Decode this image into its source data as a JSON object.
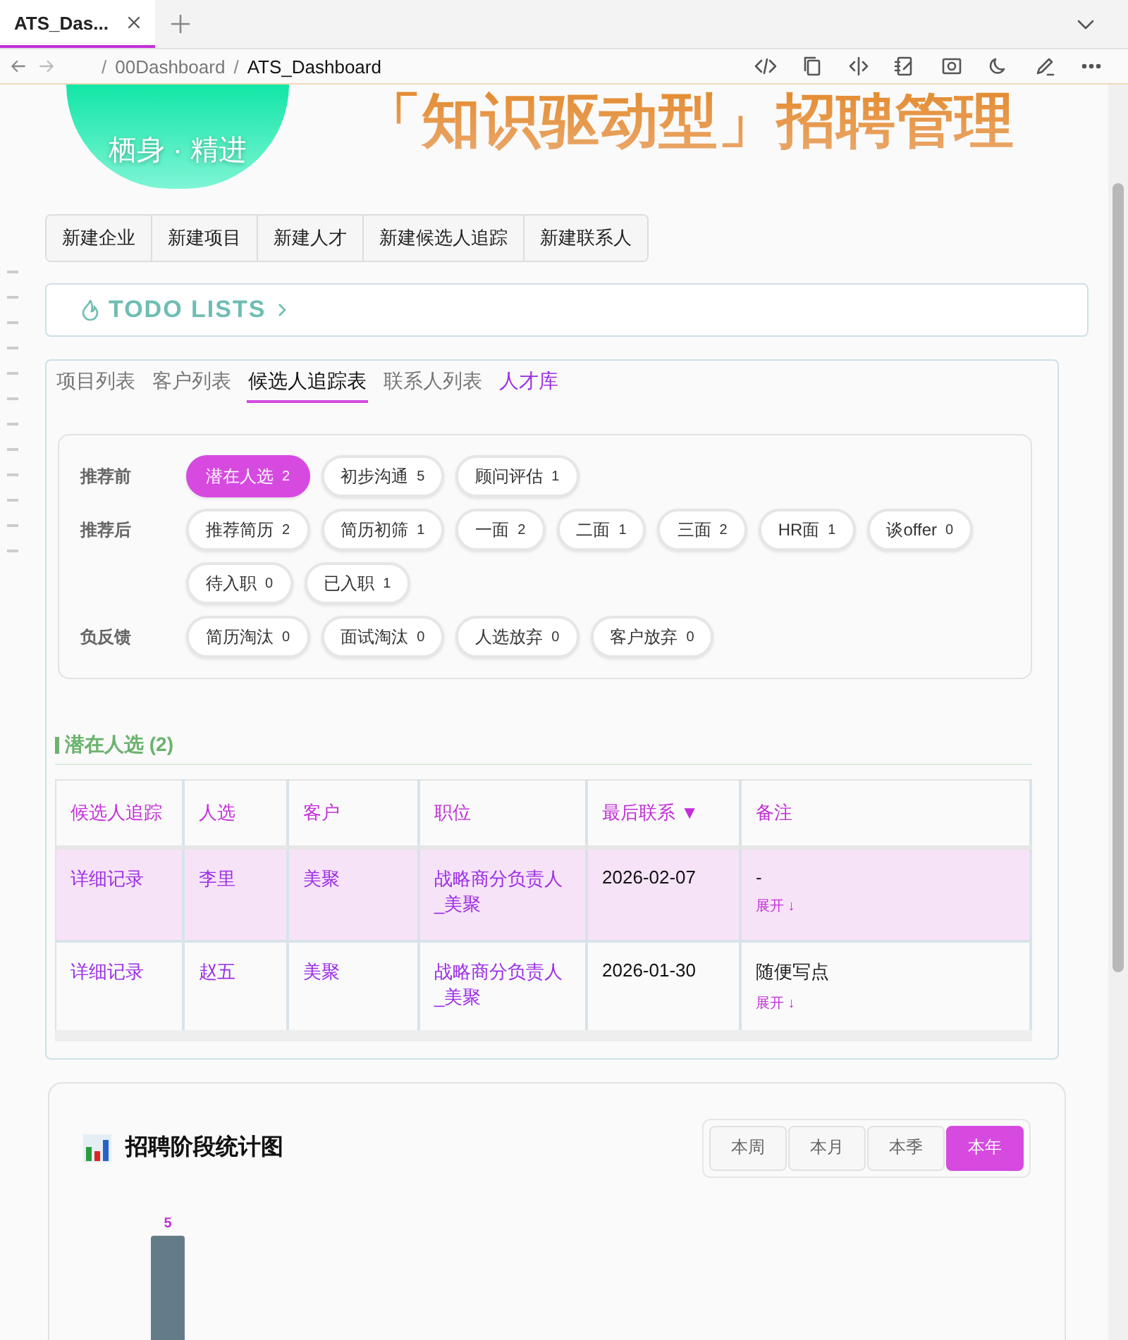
{
  "browser": {
    "tabs": [
      {
        "label": "ATS_Das...",
        "selected": true
      }
    ],
    "breadcrumb": [
      {
        "separator": "/",
        "label": "00Dashboard"
      },
      {
        "separator": "/",
        "label": "ATS_Dashboard"
      }
    ]
  },
  "header": {
    "badge": "栖身 · 精进",
    "title": "「知识驱动型」招聘管理"
  },
  "quick_buttons": [
    "新建企业",
    "新建项目",
    "新建人才",
    "新建候选人追踪",
    "新建联系人"
  ],
  "todo": {
    "label": "TODO LISTS"
  },
  "view_tabs": [
    {
      "label": "项目列表",
      "selected": false,
      "kind": "tab"
    },
    {
      "label": "客户列表",
      "selected": false,
      "kind": "tab"
    },
    {
      "label": "候选人追踪表",
      "selected": true,
      "kind": "tab"
    },
    {
      "label": "联系人列表",
      "selected": false,
      "kind": "tab"
    },
    {
      "label": "人才库",
      "selected": false,
      "kind": "link"
    }
  ],
  "stage_groups": [
    {
      "label": "推荐前",
      "stages": [
        {
          "label": "潜在人选",
          "count": "2",
          "selected": true
        },
        {
          "label": "初步沟通",
          "count": "5",
          "selected": false
        },
        {
          "label": "顾问评估",
          "count": "1",
          "selected": false
        }
      ]
    },
    {
      "label": "推荐后",
      "stages": [
        {
          "label": "推荐简历",
          "count": "2",
          "selected": false
        },
        {
          "label": "简历初筛",
          "count": "1",
          "selected": false
        },
        {
          "label": "一面",
          "count": "2",
          "selected": false
        },
        {
          "label": "二面",
          "count": "1",
          "selected": false
        },
        {
          "label": "三面",
          "count": "2",
          "selected": false
        },
        {
          "label": "HR面",
          "count": "1",
          "selected": false
        },
        {
          "label": "谈offer",
          "count": "0",
          "selected": false
        },
        {
          "label": "待入职",
          "count": "0",
          "selected": false
        },
        {
          "label": "已入职",
          "count": "1",
          "selected": false
        }
      ]
    },
    {
      "label": "负反馈",
      "stages": [
        {
          "label": "简历淘汰",
          "count": "0",
          "selected": false
        },
        {
          "label": "面试淘汰",
          "count": "0",
          "selected": false
        },
        {
          "label": "人选放弃",
          "count": "0",
          "selected": false
        },
        {
          "label": "客户放弃",
          "count": "0",
          "selected": false
        }
      ]
    }
  ],
  "table": {
    "title": "潜在人选 (2)",
    "columns": [
      "候选人追踪",
      "人选",
      "客户",
      "职位",
      "最后联系 ▼",
      "备注"
    ],
    "rows": [
      {
        "selected": true,
        "tracking": "详细记录",
        "candidate": "李里",
        "client": "美聚",
        "position": "战略商分负责人_美聚",
        "last_contact": "2026-02-07",
        "note": "-",
        "expand": "展开 ↓"
      },
      {
        "selected": false,
        "tracking": "详细记录",
        "candidate": "赵五",
        "client": "美聚",
        "position": "战略商分负责人_美聚",
        "last_contact": "2026-01-30",
        "note": "随便写点",
        "expand": "展开 ↓"
      }
    ]
  },
  "chart": {
    "title": "招聘阶段统计图",
    "periods": [
      {
        "label": "本周",
        "selected": false
      },
      {
        "label": "本月",
        "selected": false
      },
      {
        "label": "本季",
        "selected": false
      },
      {
        "label": "本年",
        "selected": true
      }
    ],
    "bar_label": "5"
  }
}
